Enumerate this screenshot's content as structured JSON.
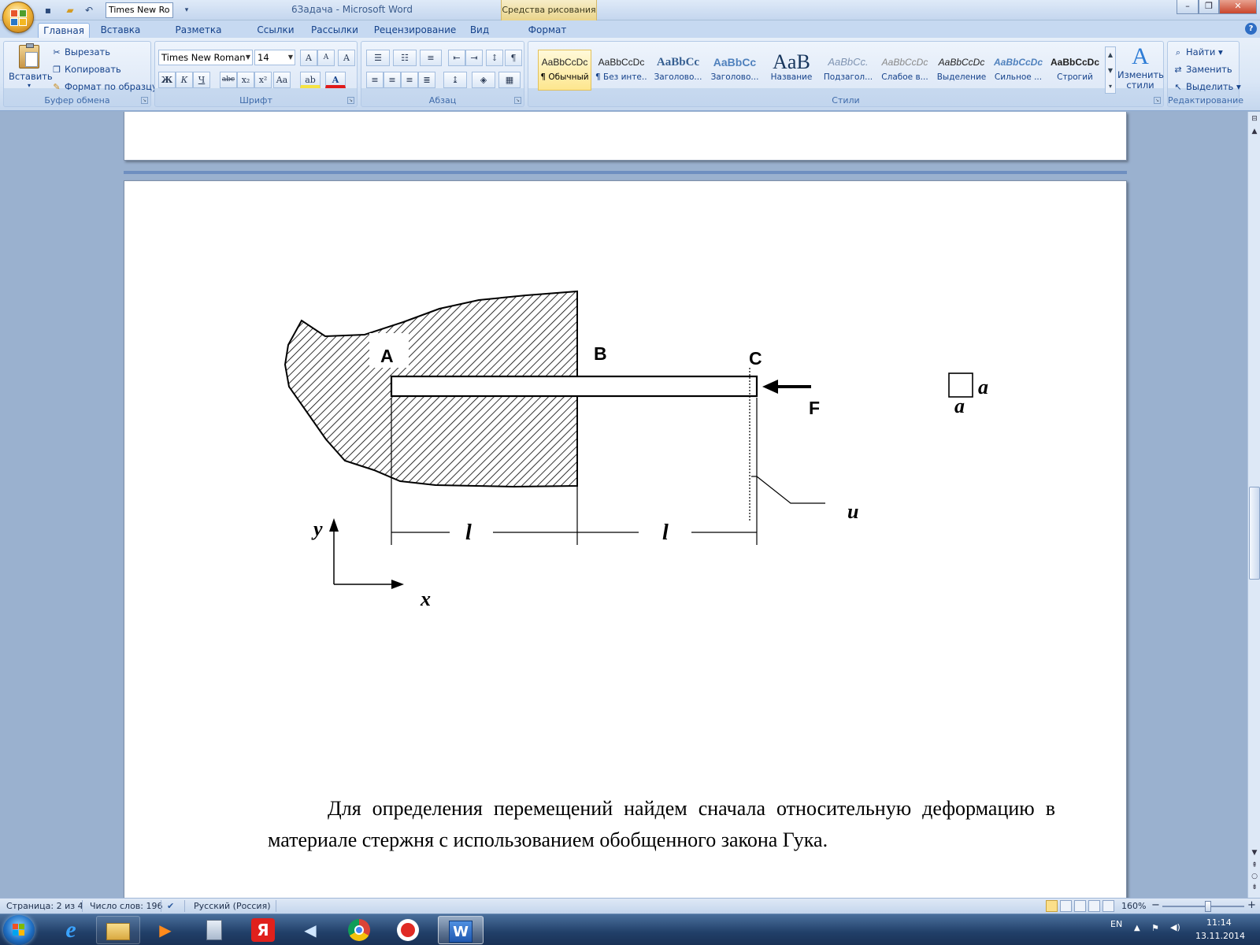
{
  "window": {
    "title": "6Задача - Microsoft Word",
    "context_tab_header": "Средства рисования",
    "qat_font": "Times New Ro",
    "controls": {
      "minimize": "–",
      "maximize": "❐",
      "close": "✕"
    }
  },
  "ribbon": {
    "tabs": [
      "Главная",
      "Вставка",
      "Разметка страницы",
      "Ссылки",
      "Рассылки",
      "Рецензирование",
      "Вид",
      "Формат"
    ],
    "active_tab": "Главная",
    "clipboard": {
      "paste": "Вставить",
      "cut": "Вырезать",
      "copy": "Копировать",
      "format_painter": "Формат по образцу",
      "label": "Буфер обмена"
    },
    "font": {
      "font_name": "Times New Roman",
      "font_size": "14",
      "grow": "A",
      "shrink": "A",
      "clear_format": "A",
      "bold": "Ж",
      "italic": "К",
      "underline": "Ч",
      "strike": "abc",
      "subscript": "x₂",
      "superscript": "x²",
      "change_case": "Aa",
      "highlight": "ab",
      "font_color": "A",
      "label": "Шрифт"
    },
    "paragraph": {
      "label": "Абзац",
      "pilcrow": "¶"
    },
    "styles": {
      "label": "Стили",
      "items": [
        {
          "preview": "AaBbCcDc",
          "name": "¶ Обычный"
        },
        {
          "preview": "AaBbCcDc",
          "name": "¶ Без инте..."
        },
        {
          "preview": "AaBbCc",
          "name": "Заголово..."
        },
        {
          "preview": "AaBbCc",
          "name": "Заголово..."
        },
        {
          "preview": "AaB",
          "name": "Название"
        },
        {
          "preview": "AaBbCc.",
          "name": "Подзагол..."
        },
        {
          "preview": "AaBbCcDc",
          "name": "Слабое в..."
        },
        {
          "preview": "AaBbCcDc",
          "name": "Выделение"
        },
        {
          "preview": "AaBbCcDc",
          "name": "Сильное ..."
        },
        {
          "preview": "AaBbCcDc",
          "name": "Строгий"
        }
      ],
      "change_styles_line1": "Изменить",
      "change_styles_line2": "стили"
    },
    "editing": {
      "label": "Редактирование",
      "find": "Найти",
      "replace": "Заменить",
      "select": "Выделить"
    }
  },
  "figure": {
    "label_A": "A",
    "label_B": "B",
    "label_C": "C",
    "label_F": "F",
    "label_u": "u",
    "label_l1": "l",
    "label_l2": "l",
    "label_y": "y",
    "label_x": "x",
    "label_a_right": "a",
    "label_a_bottom": "a"
  },
  "document": {
    "paragraph": "Для определения перемещений найдем сначала относительную деформацию в материале стержня с использованием обобщенного закона Гука."
  },
  "statusbar": {
    "page": "Страница: 2 из 4",
    "words": "Число слов: 196",
    "language": "Русский (Россия)",
    "zoom": "160%",
    "zoom_minus": "−",
    "zoom_plus": "+"
  },
  "taskbar": {
    "lang": "EN",
    "time": "11:14",
    "date": "13.11.2014",
    "apps": [
      "e",
      "",
      "▶",
      "",
      "Я",
      "",
      "",
      "",
      "W"
    ]
  }
}
